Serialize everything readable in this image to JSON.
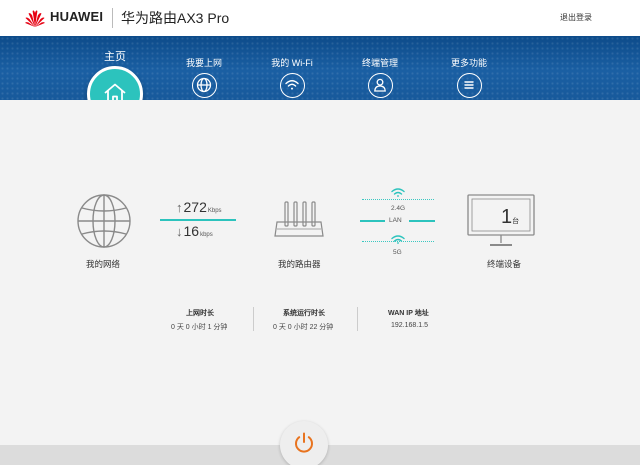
{
  "header": {
    "brand": "HUAWEI",
    "product": "华为路由AX3 Pro",
    "logout": "退出登录"
  },
  "nav": {
    "home": "主页",
    "items": [
      {
        "label": "我要上网",
        "icon": "globe-icon"
      },
      {
        "label": "我的 Wi-Fi",
        "icon": "wifi-icon"
      },
      {
        "label": "终端管理",
        "icon": "user-icon"
      },
      {
        "label": "更多功能",
        "icon": "menu-icon"
      }
    ]
  },
  "network": {
    "label": "我的网络",
    "upload": "272",
    "upload_unit": "Kbps",
    "download": "16",
    "download_unit": "kbps"
  },
  "router": {
    "label": "我的路由器",
    "band_24": "2.4G",
    "lan": "LAN",
    "band_5": "5G"
  },
  "devices": {
    "label": "终端设备",
    "count": "1",
    "count_unit": "台"
  },
  "stats": [
    {
      "title": "上网时长",
      "value": "0 天 0 小时 1 分钟"
    },
    {
      "title": "系统运行时长",
      "value": "0 天 0 小时 22 分钟"
    },
    {
      "title": "WAN IP 地址",
      "value": "192.168.1.5"
    }
  ],
  "colors": {
    "accent": "#2cc3bd",
    "nav_blue": "#17599b",
    "power": "#e8731f",
    "logo": "#e60012"
  }
}
